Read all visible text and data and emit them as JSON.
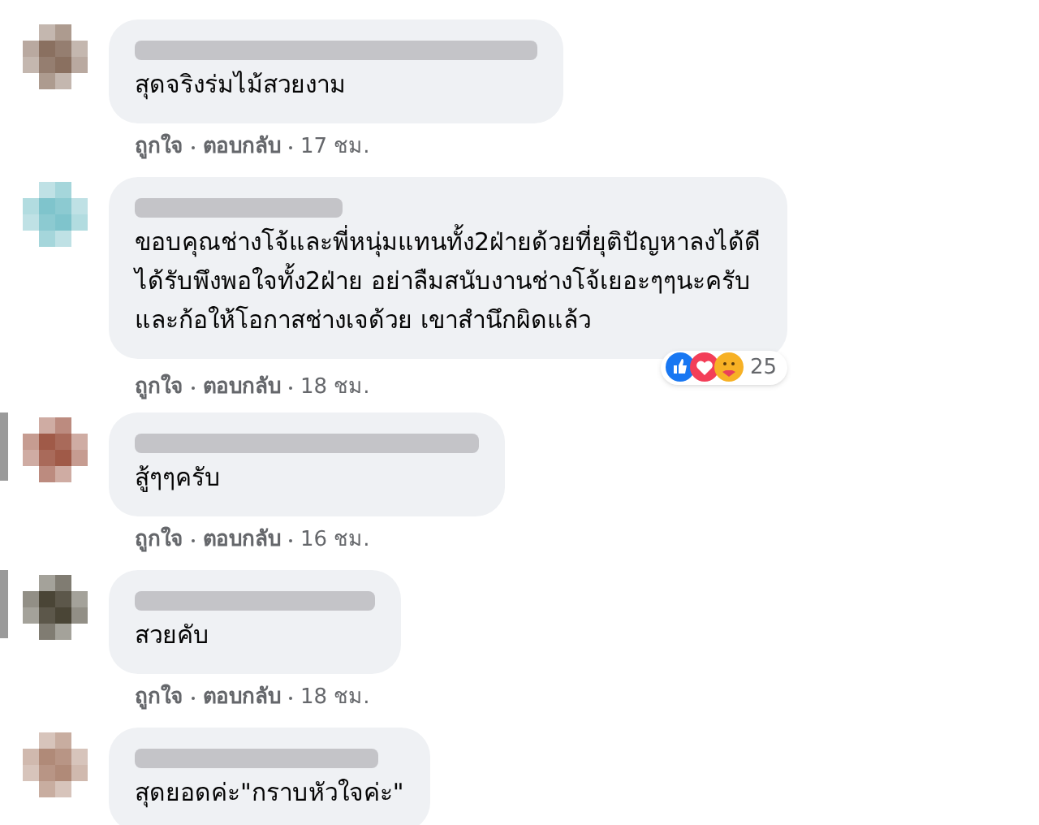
{
  "comments": [
    {
      "color": "#8a7060",
      "marker": false,
      "text": [
        "สุดจริงร่มไม้สวยงาม"
      ],
      "like": "ถูกใจ",
      "reply": "ตอบกลับ",
      "time": "17 ชม."
    },
    {
      "color": "#7fc4cc",
      "marker": false,
      "text": [
        "ขอบคุณช่างโจ้และพี่หนุ่มแทนทั้ง2ฝ่ายด้วยที่ยุติปัญหาลงได้ดี",
        "ได้รับพึงพอใจทั้ง2ฝ่าย อย่าลืมสนับงานช่างโจ้เยอะๆๆนะครับ",
        "และก้อให้โอกาสช่างเจด้วย เขาสำนึกผิดแล้ว"
      ],
      "reactions": "25",
      "like": "ถูกใจ",
      "reply": "ตอบกลับ",
      "time": "18 ชม."
    },
    {
      "color": "#a05a48",
      "marker": true,
      "text": [
        "สู้ๆๆครับ"
      ],
      "like": "ถูกใจ",
      "reply": "ตอบกลับ",
      "time": "16 ชม."
    },
    {
      "color": "#4a4536",
      "marker": true,
      "text": [
        "สวยคับ"
      ],
      "like": "ถูกใจ",
      "reply": "ตอบกลับ",
      "time": "18 ชม."
    },
    {
      "color": "#b08a78",
      "marker": false,
      "text": [
        "สุดยอดค่ะ\"กราบหัวใจค่ะ\""
      ]
    }
  ]
}
